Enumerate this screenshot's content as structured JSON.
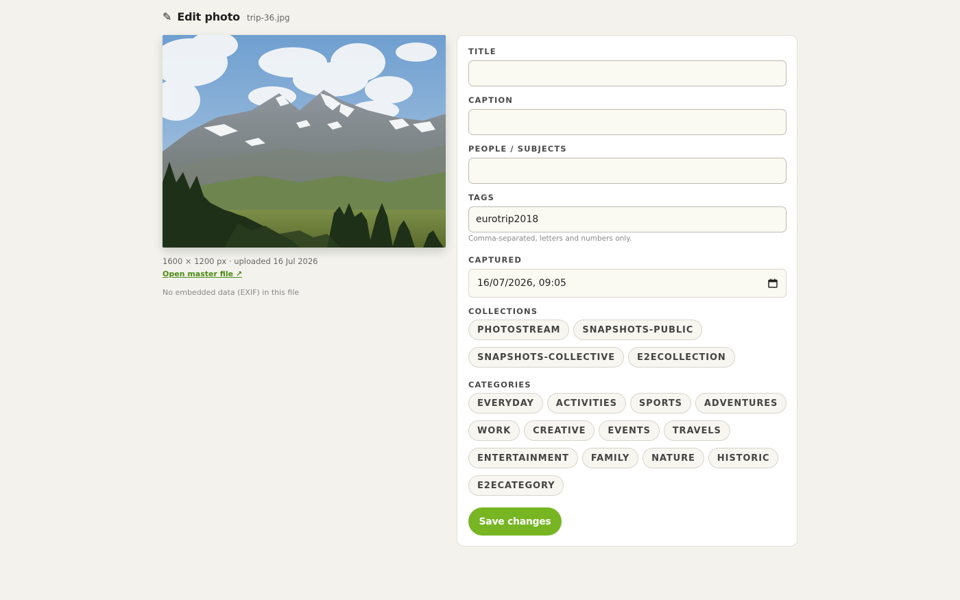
{
  "header": {
    "icon": "pencil-icon",
    "title": "Edit photo",
    "filename": "trip-36.jpg"
  },
  "photo": {
    "dimensions": "1600 × 1200 px · uploaded 16 Jul 2026",
    "master_link": "Open master file ↗",
    "exif_note": "No embedded data (EXIF) in this file"
  },
  "form": {
    "title": {
      "label": "TITLE",
      "value": ""
    },
    "caption": {
      "label": "CAPTION",
      "value": ""
    },
    "people": {
      "label": "PEOPLE / SUBJECTS",
      "value": ""
    },
    "tags": {
      "label": "TAGS",
      "value": "eurotrip2018",
      "hint": "Comma-separated, letters and numbers only."
    },
    "captured": {
      "label": "CAPTURED",
      "value": "16/07/2026, 09:05",
      "icon": "calendar-icon"
    },
    "collections": {
      "label": "COLLECTIONS",
      "items": [
        "PHOTOSTREAM",
        "SNAPSHOTS-PUBLIC",
        "SNAPSHOTS-COLLECTIVE",
        "E2ECOLLECTION"
      ]
    },
    "categories": {
      "label": "CATEGORIES",
      "items": [
        "EVERYDAY",
        "ACTIVITIES",
        "SPORTS",
        "ADVENTURES",
        "WORK",
        "CREATIVE",
        "EVENTS",
        "TRAVELS",
        "ENTERTAINMENT",
        "FAMILY",
        "NATURE",
        "HISTORIC",
        "E2ECATEGORY"
      ]
    },
    "save_label": "Save changes"
  },
  "colors": {
    "accent": "#77b523",
    "link": "#4c8a14",
    "background": "#f3f2ec"
  }
}
